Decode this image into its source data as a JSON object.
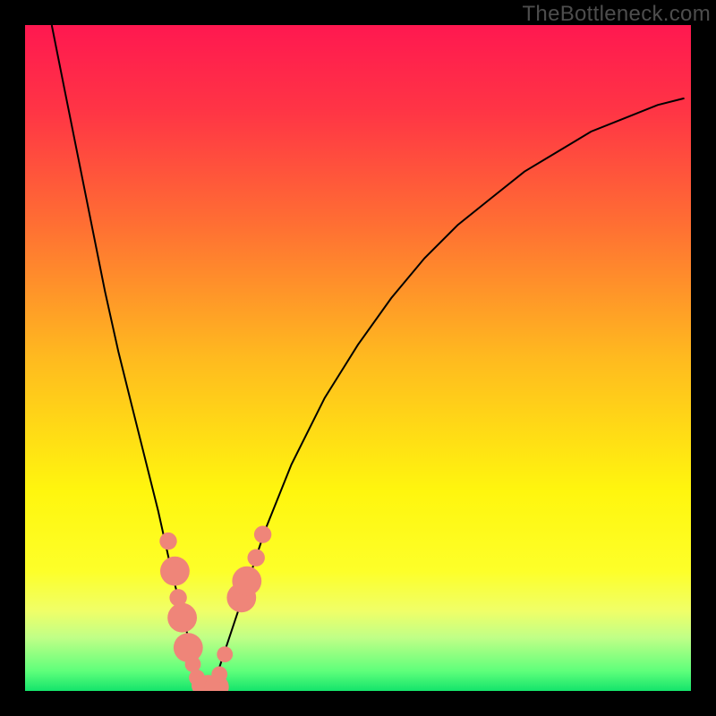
{
  "watermark": "TheBottleneck.com",
  "gradient": {
    "stops": [
      {
        "offset": 0.0,
        "color": "#ff1850"
      },
      {
        "offset": 0.13,
        "color": "#ff3545"
      },
      {
        "offset": 0.3,
        "color": "#ff6f33"
      },
      {
        "offset": 0.5,
        "color": "#ffba1f"
      },
      {
        "offset": 0.7,
        "color": "#fff60e"
      },
      {
        "offset": 0.82,
        "color": "#fdff29"
      },
      {
        "offset": 0.88,
        "color": "#f0ff68"
      },
      {
        "offset": 0.92,
        "color": "#c0ff87"
      },
      {
        "offset": 0.97,
        "color": "#5fff7b"
      },
      {
        "offset": 1.0,
        "color": "#14e46b"
      }
    ]
  },
  "chart_data": {
    "type": "line",
    "title": "",
    "xlabel": "",
    "ylabel": "",
    "xlim": [
      0,
      100
    ],
    "ylim": [
      0,
      100
    ],
    "series": [
      {
        "name": "bottleneck-curve",
        "x": [
          4,
          6,
          8,
          10,
          12,
          14,
          16,
          18,
          20,
          22,
          23,
          24,
          25,
          26,
          27,
          28,
          29,
          30,
          32,
          34,
          36,
          40,
          45,
          50,
          55,
          60,
          65,
          70,
          75,
          80,
          85,
          90,
          95,
          99
        ],
        "values": [
          100,
          90,
          80,
          70,
          60,
          51,
          43,
          35,
          27,
          18,
          14,
          10,
          6,
          3,
          1,
          1,
          3,
          6,
          12,
          18,
          24,
          34,
          44,
          52,
          59,
          65,
          70,
          74,
          78,
          81,
          84,
          86,
          88,
          89
        ]
      }
    ],
    "markers": {
      "name": "highlight-dots",
      "color": "#ef8579",
      "points": [
        {
          "x": 21.5,
          "y": 22.5,
          "r": 1.3
        },
        {
          "x": 23.0,
          "y": 14.0,
          "r": 1.3
        },
        {
          "x": 22.5,
          "y": 18.0,
          "r": 2.2
        },
        {
          "x": 23.6,
          "y": 11.0,
          "r": 2.2
        },
        {
          "x": 24.5,
          "y": 6.5,
          "r": 2.2
        },
        {
          "x": 25.2,
          "y": 4.0,
          "r": 1.2
        },
        {
          "x": 25.8,
          "y": 2.0,
          "r": 1.2
        },
        {
          "x": 26.5,
          "y": 0.8,
          "r": 1.5
        },
        {
          "x": 27.5,
          "y": 0.6,
          "r": 1.8
        },
        {
          "x": 28.8,
          "y": 0.6,
          "r": 1.8
        },
        {
          "x": 29.2,
          "y": 2.5,
          "r": 1.2
        },
        {
          "x": 30.0,
          "y": 5.5,
          "r": 1.2
        },
        {
          "x": 32.5,
          "y": 14.0,
          "r": 2.2
        },
        {
          "x": 33.3,
          "y": 16.5,
          "r": 2.2
        },
        {
          "x": 34.7,
          "y": 20.0,
          "r": 1.3
        },
        {
          "x": 35.7,
          "y": 23.5,
          "r": 1.3
        }
      ]
    }
  }
}
